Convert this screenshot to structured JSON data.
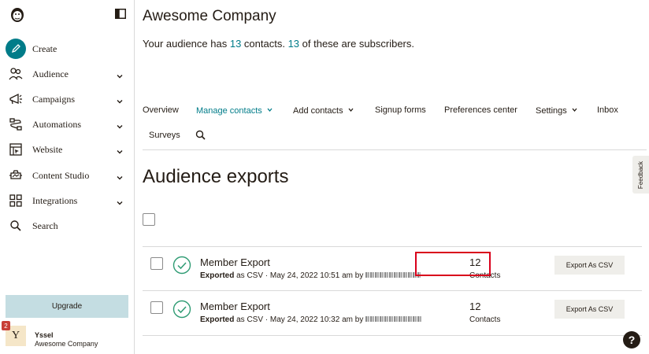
{
  "sidebar": {
    "items": [
      {
        "label": "Create",
        "icon": "pencil-icon",
        "has_chevron": false
      },
      {
        "label": "Audience",
        "icon": "audience-icon",
        "has_chevron": true
      },
      {
        "label": "Campaigns",
        "icon": "megaphone-icon",
        "has_chevron": true
      },
      {
        "label": "Automations",
        "icon": "automation-icon",
        "has_chevron": true
      },
      {
        "label": "Website",
        "icon": "website-icon",
        "has_chevron": true
      },
      {
        "label": "Content Studio",
        "icon": "content-studio-icon",
        "has_chevron": true
      },
      {
        "label": "Integrations",
        "icon": "grid-icon",
        "has_chevron": true
      },
      {
        "label": "Search",
        "icon": "search-icon",
        "has_chevron": false
      }
    ],
    "upgrade_label": "Upgrade",
    "user": {
      "avatar_letter": "Y",
      "notifications": "2",
      "name": "Yssel",
      "org": "Awesome Company"
    }
  },
  "header": {
    "company": "Awesome Company",
    "summary_prefix": "Your audience has ",
    "contacts": "13",
    "summary_middle": " contacts. ",
    "subscribers": "13",
    "summary_suffix": " of these are subscribers."
  },
  "tabs": [
    {
      "label": "Overview"
    },
    {
      "label": "Manage contacts",
      "active": true,
      "dropdown": true
    },
    {
      "label": "Add contacts",
      "dropdown": true
    },
    {
      "label": "Signup forms"
    },
    {
      "label": "Preferences center"
    },
    {
      "label": "Settings",
      "dropdown": true
    },
    {
      "label": "Inbox"
    },
    {
      "label": "Surveys"
    }
  ],
  "section_title": "Audience exports",
  "exports": [
    {
      "name": "Member Export",
      "status": "Exported",
      "detail": " as CSV · May 24, 2022 10:51 am by ",
      "count": "12",
      "count_label": "Contacts",
      "button": "Export As CSV"
    },
    {
      "name": "Member Export",
      "status": "Exported",
      "detail": " as CSV · May 24, 2022 10:32 am by ",
      "count": "12",
      "count_label": "Contacts",
      "button": "Export As CSV"
    }
  ],
  "feedback_label": "Feedback",
  "help_label": "?",
  "colors": {
    "accent": "#007c89",
    "upgrade_bg": "#c4dde2",
    "highlight": "#d9001b",
    "success": "#2e9b73"
  }
}
